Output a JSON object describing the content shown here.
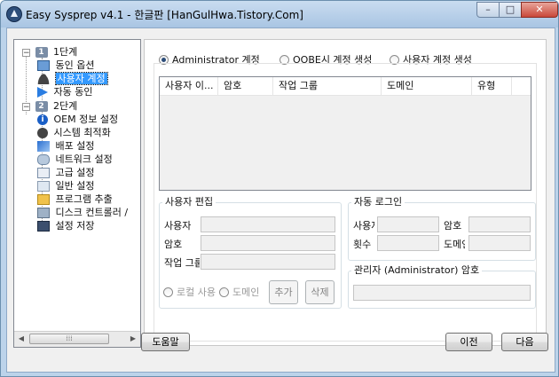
{
  "window": {
    "title": "Easy Sysprep v4.1 - 한글판 [HanGulHwa.Tistory.Com]"
  },
  "tree": {
    "steps": [
      {
        "number": "1",
        "label": "1단계",
        "children": [
          {
            "icon": "monitor-icon",
            "label": "동인 옵션"
          },
          {
            "icon": "user-icon",
            "label": "사용자 계정",
            "selected": true
          },
          {
            "icon": "arrow-icon",
            "label": "자동 동인"
          }
        ]
      },
      {
        "number": "2",
        "label": "2단계",
        "children": [
          {
            "icon": "info-icon",
            "label": "OEM 정보 설정"
          },
          {
            "icon": "gear-icon",
            "label": "시스템 최적화"
          },
          {
            "icon": "deploy-icon",
            "label": "배포 설정"
          },
          {
            "icon": "network-icon",
            "label": "네트워크 설정"
          },
          {
            "icon": "advanced-icon",
            "label": "고급 설정"
          },
          {
            "icon": "general-icon",
            "label": "일반 설정"
          },
          {
            "icon": "program-icon",
            "label": "프로그램 추출"
          },
          {
            "icon": "disk-icon",
            "label": "디스크 컨트롤러 /"
          },
          {
            "icon": "save-icon",
            "label": "설정 저장"
          }
        ]
      }
    ]
  },
  "account_type": {
    "options": [
      {
        "label": "Administrator 계정",
        "checked": true
      },
      {
        "label": "OOBE시 계정 생성",
        "checked": false
      },
      {
        "label": "사용자 계정 생성",
        "checked": false
      }
    ]
  },
  "user_list": {
    "columns": [
      "사용자 이...",
      "암호",
      "작업 그룹",
      "도메인",
      "유형"
    ]
  },
  "user_edit": {
    "title": "사용자 편집",
    "labels": {
      "user": "사용자",
      "password": "암호",
      "workgroup": "작업 그룹"
    },
    "join_options": [
      {
        "label": "로컬 사용",
        "checked": false
      },
      {
        "label": "도메인",
        "checked": false
      }
    ],
    "add_button": "추가",
    "delete_button": "삭제"
  },
  "auto_login": {
    "title": "자동 로그인",
    "labels": {
      "user": "사용자",
      "password": "암호",
      "count": "횟수",
      "domain": "도메인"
    }
  },
  "admin_password": {
    "title": "관리자 (Administrator) 암호"
  },
  "footer": {
    "help": "도움말",
    "prev": "이전",
    "next": "다음"
  }
}
